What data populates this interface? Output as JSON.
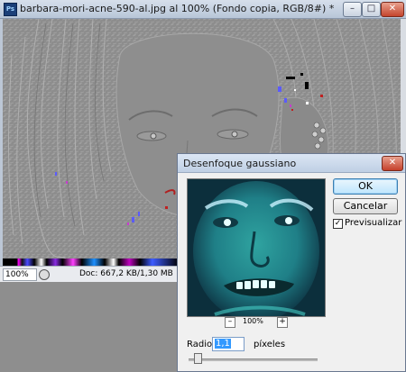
{
  "document": {
    "title": "barbara-mori-acne-590-al.jpg al 100% (Fondo copia, RGB/8#) *",
    "app_icon": "Ps",
    "window_controls": {
      "minimize": "–",
      "maximize": "□",
      "close": "✕"
    },
    "status": {
      "zoom": "100%",
      "doc_size": "Doc: 667,2 KB/1,30 MB"
    }
  },
  "dialog": {
    "title": "Desenfoque gaussiano",
    "close_glyph": "✕",
    "ok_label": "OK",
    "cancel_label": "Cancelar",
    "preview_label": "Previsualizar",
    "preview_checked": true,
    "check_glyph": "✓",
    "zoom": "100%",
    "zoom_minus": "–",
    "zoom_plus": "+",
    "radius_label": "Radio:",
    "radius_value": "1,1",
    "radius_unit": "píxeles"
  }
}
